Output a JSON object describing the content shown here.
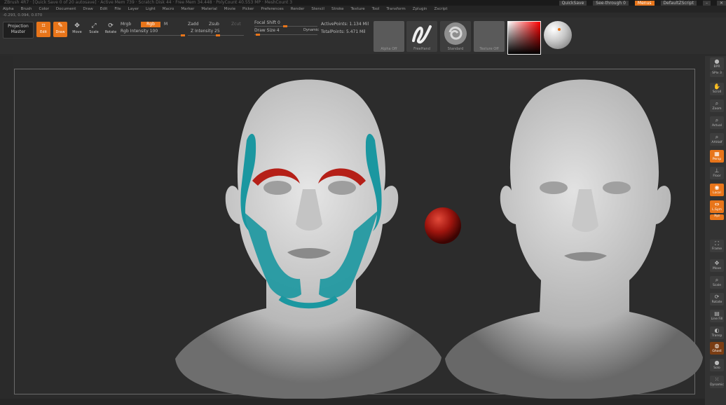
{
  "titlebar": {
    "text": "ZBrush 4R7 · [Quick Save 0 of 20 autosave] · Active Mem 739 · Scratch Disk 44 · Free Mem 34.448 · PolyCount 40.553 MP · MeshCount 3"
  },
  "topright": {
    "quicksave": "QuickSave",
    "see_through": "See-through 0",
    "menus": "Menus",
    "default_zscript": "DefaultZScript"
  },
  "menubar": {
    "items": [
      "Alpha",
      "Brush",
      "Color",
      "Document",
      "Draw",
      "Edit",
      "File",
      "Layer",
      "Light",
      "Macro",
      "Marker",
      "Material",
      "Movie",
      "Picker",
      "Preferences",
      "Render",
      "Stencil",
      "Stroke",
      "Texture",
      "Tool",
      "Transform",
      "Zplugin",
      "Zscript"
    ]
  },
  "coords": "-0.293, 0.094, 0.070",
  "toolbar": {
    "projection_master": [
      "Projection",
      "Master"
    ],
    "edit": "Edit",
    "draw": "Draw",
    "move": "Move",
    "scale": "Scale",
    "rotate": "Rotate",
    "mrgb": "Mrgb",
    "rgb": "Rgb",
    "m": "M",
    "rgb_intensity": "Rgb Intensity 100",
    "zadd": "Zadd",
    "zsub": "Zsub",
    "zcut": "Zcut",
    "z_intensity": "Z Intensity 25",
    "focal_shift": "Focal Shift 0",
    "draw_size": "Draw Size 4",
    "dynamic": "Dynamic",
    "active_points": "ActivePoints: 1.134 Mil",
    "total_points": "TotalPoints: 5.471 Mil",
    "swatches": [
      "Alpha Off",
      "FreeHand",
      "Standard",
      "Texture Off"
    ]
  },
  "rightshelf": {
    "items": [
      "BPR",
      "SPix 3",
      "Scroll",
      "Zoom",
      "Actual",
      "AAHalf",
      "Persp",
      "Floor",
      "Local",
      "L.Sym",
      "Xyz",
      "Frame",
      "Move",
      "Scale",
      "Rotate",
      "Line Fill",
      "Transp",
      "Ghost",
      "Solo",
      "Dynamic"
    ]
  },
  "colors": {
    "accent": "#e8751a",
    "skin": "#d4d4d4",
    "muscle_teal": "#1b97a0",
    "muscle_red": "#b52018"
  }
}
